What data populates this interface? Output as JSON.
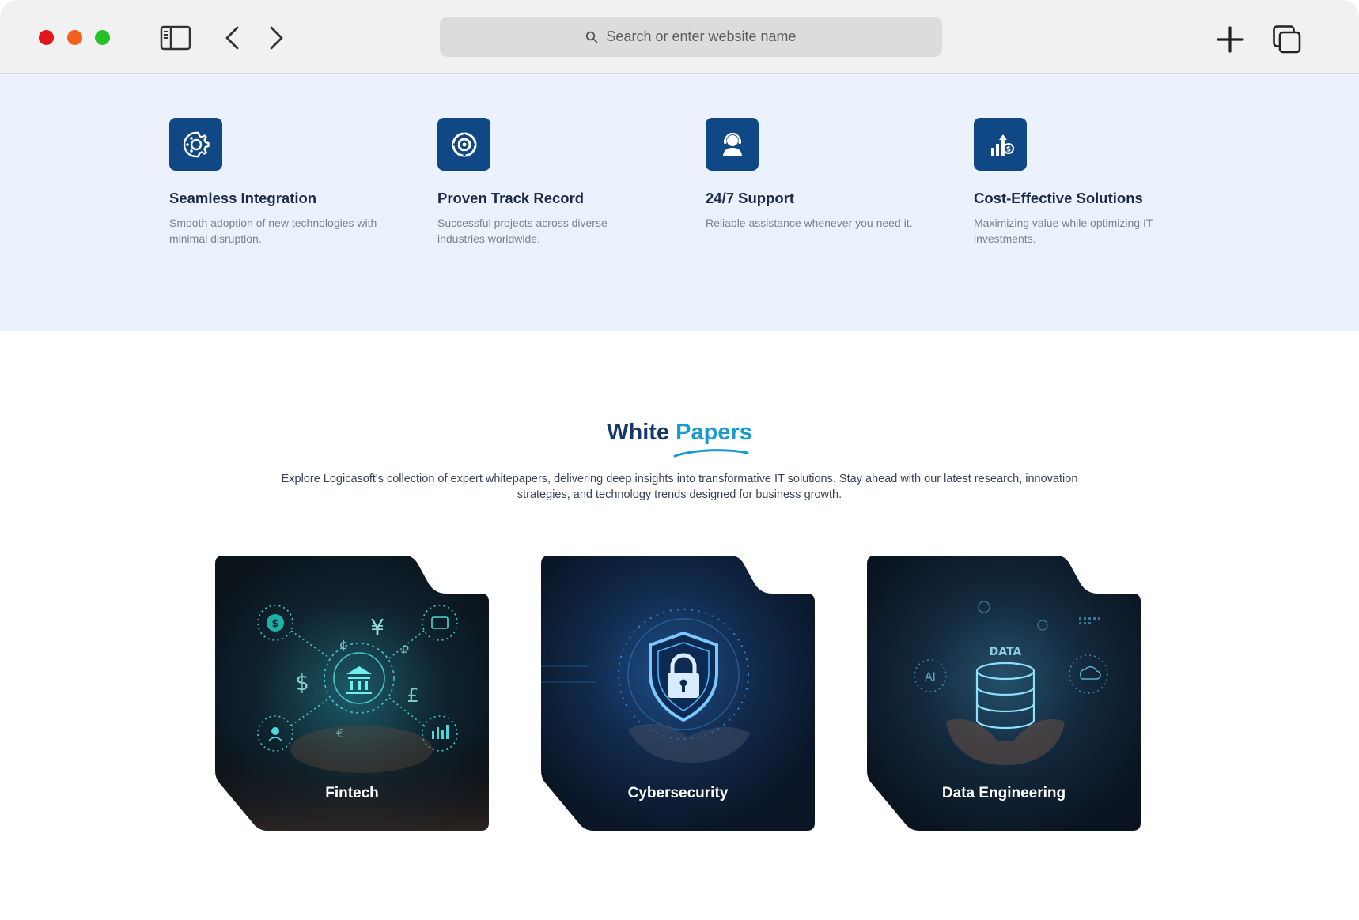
{
  "browser": {
    "address_placeholder": "Search or enter website name",
    "icons": [
      "sidebar-icon",
      "back-icon",
      "forward-icon",
      "search-icon",
      "new-tab-icon",
      "tabs-overview-icon"
    ]
  },
  "features": [
    {
      "icon": "integration-gear-icon",
      "title": "Seamless Integration",
      "description": "Smooth adoption of new technologies with minimal disruption."
    },
    {
      "icon": "target-icon",
      "title": "Proven Track Record",
      "description": "Successful projects across diverse industries worldwide."
    },
    {
      "icon": "support-agent-icon",
      "title": "24/7 Support",
      "description": "Reliable assistance whenever you need it."
    },
    {
      "icon": "cost-growth-icon",
      "title": "Cost-Effective Solutions",
      "description": "Maximizing value while optimizing IT investments."
    }
  ],
  "white_papers": {
    "heading_part1": "White",
    "heading_part2": "Papers",
    "description": "Explore Logicasoft's collection of expert whitepapers, delivering deep insights into transformative IT solutions. Stay ahead with our latest research, innovation strategies, and technology trends designed for business growth.",
    "cards": [
      {
        "label": "Fintech",
        "image": "fintech-bank-icon"
      },
      {
        "label": "Cybersecurity",
        "image": "shield-lock-icon"
      },
      {
        "label": "Data Engineering",
        "image": "data-database-icon"
      }
    ]
  },
  "colors": {
    "brand_navy": "#104785",
    "heading_navy": "#16386c",
    "accent_blue": "#1a9bd0",
    "feature_band": "#ebf2fd",
    "card_dark": "#0b1526"
  }
}
